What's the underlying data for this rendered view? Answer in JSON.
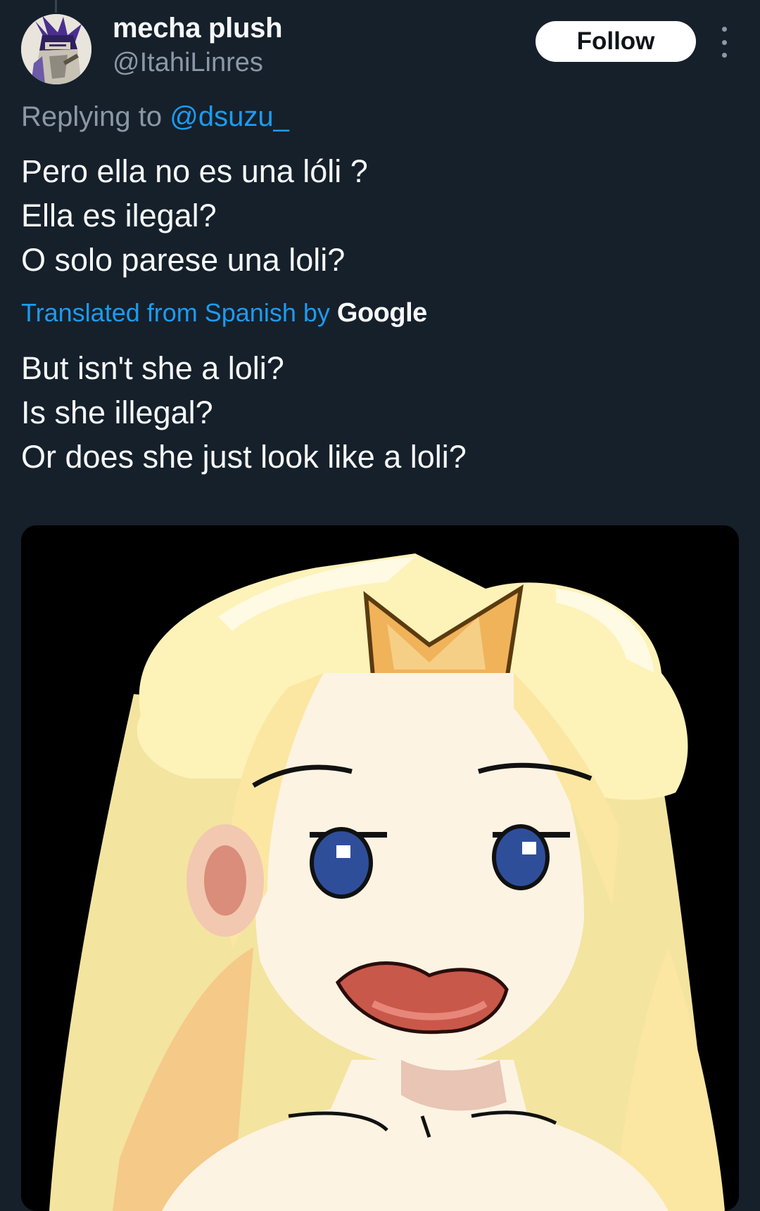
{
  "author": {
    "display_name": "mecha plush",
    "handle": "@ItahiLinres",
    "avatar_icon": "avatar-image"
  },
  "actions": {
    "follow_label": "Follow",
    "more_icon": "more-vertical-icon"
  },
  "reply": {
    "prefix": "Replying to",
    "mention": "@dsuzu_"
  },
  "tweet": {
    "lines": [
      "Pero ella no es una lóli ?",
      "Ella es ilegal?",
      "O solo parese una loli?"
    ]
  },
  "translation": {
    "note": "Translated from Spanish by",
    "provider": "Google",
    "lines": [
      "But isn't she a loli?",
      "Is she illegal?",
      "Or does she just look like a loli?"
    ]
  },
  "colors": {
    "background": "#15202b",
    "text": "#f7f9f9",
    "secondary_text": "#8b98a5",
    "accent": "#1d9bf0"
  }
}
